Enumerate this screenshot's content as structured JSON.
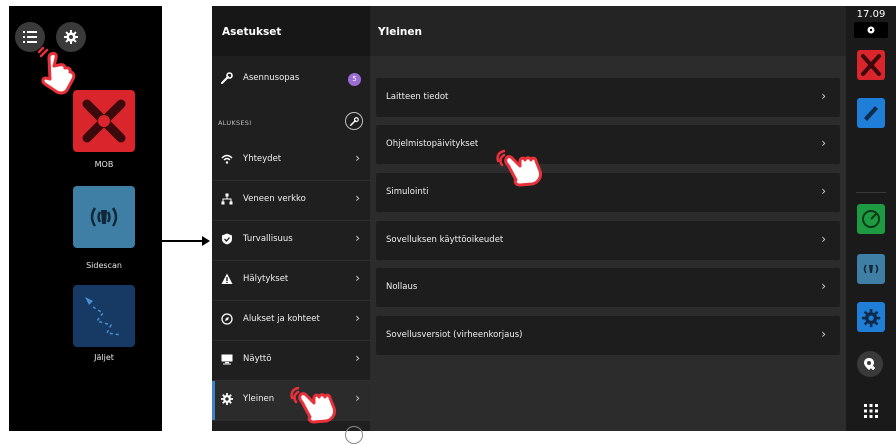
{
  "home": {
    "apps": [
      {
        "label": "MOB",
        "icon": "mob-icon"
      },
      {
        "label": "Sidescan",
        "icon": "sidescan-icon"
      },
      {
        "label": "Jäljet",
        "icon": "tracks-icon"
      }
    ]
  },
  "settings": {
    "title": "Asetukset",
    "top_item": {
      "label": "Asennusopas",
      "badge": "5"
    },
    "section_label": "ALUKSESI",
    "items": [
      {
        "label": "Yhteydet"
      },
      {
        "label": "Veneen verkko"
      },
      {
        "label": "Turvallisuus"
      },
      {
        "label": "Hälytykset"
      },
      {
        "label": "Alukset ja kohteet"
      },
      {
        "label": "Näyttö"
      },
      {
        "label": "Yleinen"
      }
    ]
  },
  "main": {
    "title": "Yleinen",
    "items": [
      {
        "label": "Laitteen tiedot"
      },
      {
        "label": "Ohjelmistopäivitykset"
      },
      {
        "label": "Simulointi"
      },
      {
        "label": "Sovelluksen käyttöoikeudet"
      },
      {
        "label": "Nollaus"
      },
      {
        "label": "Sovellusversiot (virheenkorjaus)"
      }
    ]
  },
  "statusbar": {
    "time": "17.09"
  },
  "colors": {
    "accent": "#3d84c6",
    "mob": "#d9252b",
    "sidescan": "#3f7fa6",
    "tracks": "#163a63",
    "badge": "#9b6bd6",
    "hand": "#e9313b"
  }
}
